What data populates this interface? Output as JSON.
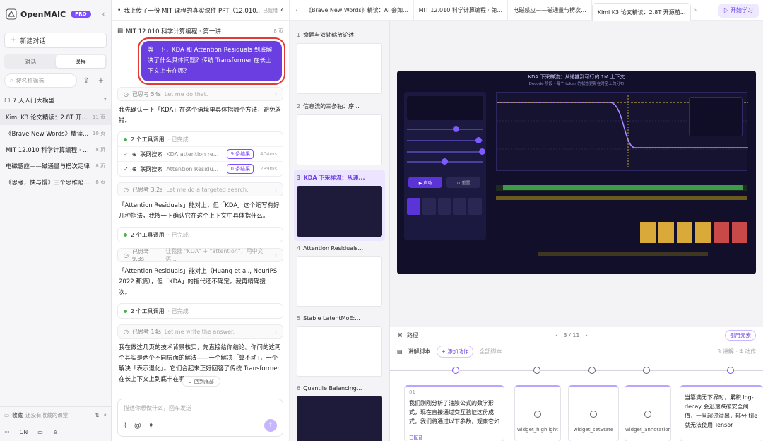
{
  "brand": {
    "name": "OpenMAIC",
    "badge": "PRO"
  },
  "left": {
    "new_chat": "新建对话",
    "tab_chat": "对话",
    "tab_course": "课程",
    "filter_placeholder": "按名称筛选",
    "group": {
      "label": "7 天入门大模型",
      "count": "7"
    },
    "courses": [
      {
        "title": "Kimi K3 论文精读：2.8T 开源...",
        "count": "11 页",
        "active": true
      },
      {
        "title": "《Brave New Words》精读...",
        "count": "10 页"
      },
      {
        "title": "MIT 12.010 科学计算编程 · 第...",
        "count": "8 页"
      },
      {
        "title": "电磁感应——磁通量与楞次定律",
        "count": "8 页"
      },
      {
        "title": "《思考，快与慢》三个思维陷...",
        "count": "8 页"
      }
    ],
    "fav_label": "收藏",
    "fav_text": "还没有收藏的课堂",
    "lang": "CN"
  },
  "chat": {
    "header_title": "我上传了一份 MIT 课程的真实课件 PPT（12.010...",
    "header_status": "已就绪",
    "sub_title": "MIT 12.010 科学计算编程 · 第一讲",
    "sub_pages": "8 页",
    "user_msg": "等一下，KDA 和 Attention Residuals 到底解决了什么具体问题？传统 Transformer 在长上下文上卡在哪？",
    "think1": "已思考 54s",
    "think1_sub": "Let me do that.",
    "p1": "我先确认一下「KDA」在这个语境里具体指哪个方法，避免答错。",
    "tools1_title": "2 个工具调用",
    "tools1_status": "· 已完成",
    "tools": [
      {
        "name": "联网搜索",
        "q": "KDA attention re...",
        "tag": "9 条结果",
        "ms": "404ms"
      },
      {
        "name": "联网搜索",
        "q": "Attention Residu...",
        "tag": "0 条结果",
        "ms": "289ms"
      }
    ],
    "think2": "已思考 3.2s",
    "think2_sub": "Let me do a targeted search.",
    "p2": "「Attention Residuals」能对上，但「KDA」这个缩写有好几种指法，我搜一下确认它在这个上下文中具体指什么。",
    "tools2_title": "2 个工具调用",
    "tools2_status": "· 已完成",
    "think3": "已思考 9.3s",
    "think3_sub": "让我搜 \"KDA\" + \"attention\"，用中文语...",
    "p3": "「Attention Residuals」能对上（Huang et al., NeurIPS 2022 那篇），但「KDA」的指代还不确定。我再精确搜一次。",
    "tools3_title": "2 个工具调用",
    "tools3_status": "· 已完成",
    "think4": "已思考 14s",
    "think4_sub": "Let me write the answer.",
    "p4": "我在做这几页的技术背景核实，先直接给你结论。你问的这两个其实是两个不同层面的解法——一个解决「算不动」，一个解决「表示退化」。它们合起来正好回答了传统 Transformer 在长上下文上到底卡在哪。",
    "back_top": "回到底部",
    "input_placeholder": "描述你想做什么，回车发送"
  },
  "slides": [
    {
      "n": "1",
      "t": "命题与双轴缩放论述"
    },
    {
      "n": "2",
      "t": "信息流的三条轴：序..."
    },
    {
      "n": "3",
      "t": "KDA 下采样流：从递..."
    },
    {
      "n": "4",
      "t": "Attention Residuals..."
    },
    {
      "n": "5",
      "t": "Stable LatentMoE:..."
    },
    {
      "n": "6",
      "t": "Quantile Balancing..."
    }
  ],
  "tabs": [
    {
      "t": "《Brave New Words》精读：AI 会如..."
    },
    {
      "t": "MIT 12.010 科学计算编程 · 第..."
    },
    {
      "t": "电磁感应——磁通量与楞次..."
    },
    {
      "t": "Kimi K3 论文精读：2.8T 开源前...",
      "on": true
    }
  ],
  "start_btn": "开始学习",
  "stage": {
    "slide_title": "KDA 下采样流：从递推到可行的 1M 上下文",
    "slide_sub": "Decode 阶段 · 每个 token 的状态更新在时空上的分布",
    "run": "▶ 启动",
    "reset": "↺ 重置",
    "page": "3 / 11",
    "bottom_left": "路径",
    "ref_btn": "引用元素",
    "script_label": "讲解脚本",
    "add_action": "+ 添加动作",
    "all_label": "全部脚本",
    "counts": "3 讲解 · 4 动作",
    "cards": [
      {
        "idx": "01",
        "body": "我们刚刚分析了油膜公式的数学形式，现在直接通过交互验证这份成式，我们将通过以下参数，观察它如"
      },
      {
        "w": "widget_highlight"
      },
      {
        "w": "widget_setState"
      },
      {
        "w": "widget_annotation"
      },
      {
        "body": "当篡满无下界时，累积 log-decay 会迅速跌破安全阈值，一旦超过溢出，部分 tile 就无法使用 Tensor"
      }
    ],
    "ok": "已配音"
  }
}
